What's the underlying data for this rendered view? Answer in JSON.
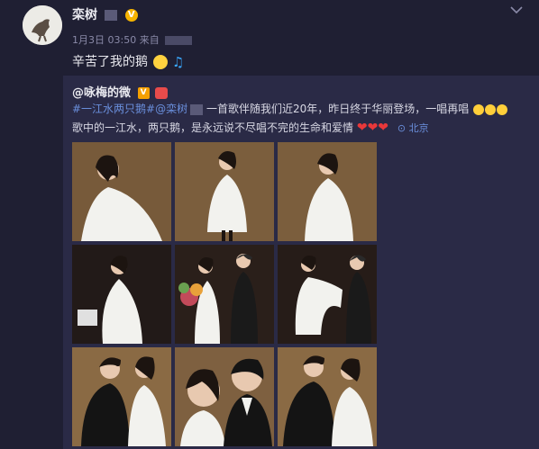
{
  "user": {
    "name": "栾树",
    "verified_mark": "V"
  },
  "meta": {
    "date": "1月3日 03:50",
    "via": "来自"
  },
  "post": {
    "text": "辛苦了我的鹅"
  },
  "repost": {
    "author": "@咏梅的微",
    "badge": "V",
    "hashtag": "#一江水两只鹅#",
    "mention": "@栾树",
    "text1": "一首歌伴随我们近20年，昨日终于华丽登场，一唱再唱",
    "text2": "歌中的一江水，两只鹅，是永远说不尽唱不完的生命和爱情",
    "location": "北京"
  },
  "photos": [
    {
      "alt": "photo-1"
    },
    {
      "alt": "photo-2"
    },
    {
      "alt": "photo-3"
    },
    {
      "alt": "photo-4"
    },
    {
      "alt": "photo-5"
    },
    {
      "alt": "photo-6"
    },
    {
      "alt": "photo-7"
    },
    {
      "alt": "photo-8"
    },
    {
      "alt": "photo-9"
    }
  ],
  "colors": {
    "background": "#1f1f33",
    "repost_background": "#2a2a46",
    "link": "#6a8fdc",
    "heart": "#e8383a"
  }
}
